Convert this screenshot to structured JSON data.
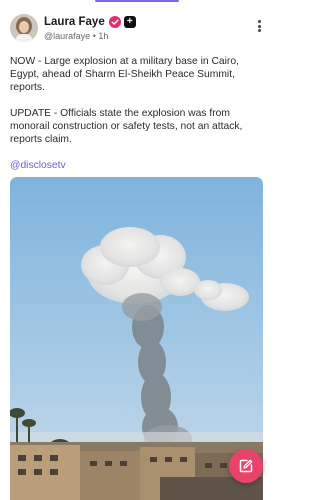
{
  "post": {
    "author": {
      "display_name": "Laura Faye",
      "handle": "@laurafaye",
      "time": "1h",
      "separator": "•",
      "verified_icon": "check-badge-icon",
      "plus_label": "+"
    },
    "paragraphs": [
      "NOW - Large explosion at a military base in Cairo, Egypt, ahead of Sharm El-Sheikh Peace Summit, reports.",
      "UPDATE - Officials state the explosion was from monorail construction or safety tests, not an attack, reports claim."
    ],
    "link": "@disclosetv",
    "media": {
      "type": "photo",
      "subject": "smoke plume over buildings"
    }
  },
  "actions": {
    "compose_icon": "compose-edit-icon",
    "more_icon": "more-vertical-icon"
  },
  "colors": {
    "accent": "#7b68ee",
    "link": "#6f5bd8",
    "compose": "#e8446b",
    "verified": "#e1306c"
  }
}
